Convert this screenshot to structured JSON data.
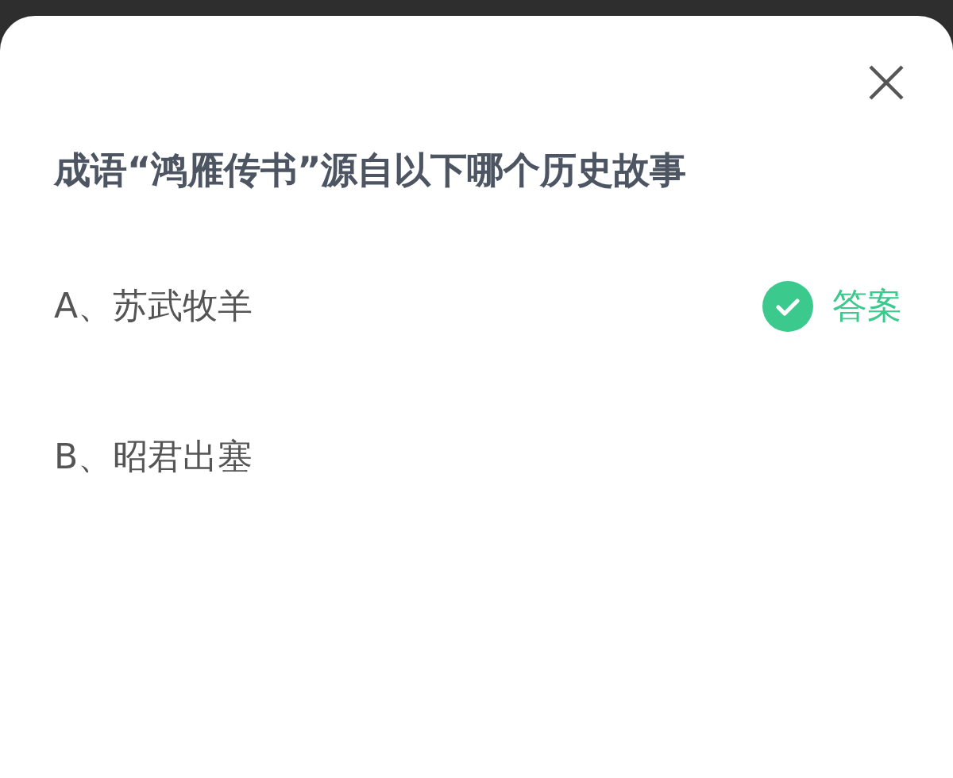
{
  "question": "成语“鸿雁传书”源自以下哪个历史故事",
  "options": [
    {
      "label": "A、苏武牧羊",
      "correct": true,
      "badge": "答案"
    },
    {
      "label": "B、昭君出塞",
      "correct": false
    }
  ]
}
